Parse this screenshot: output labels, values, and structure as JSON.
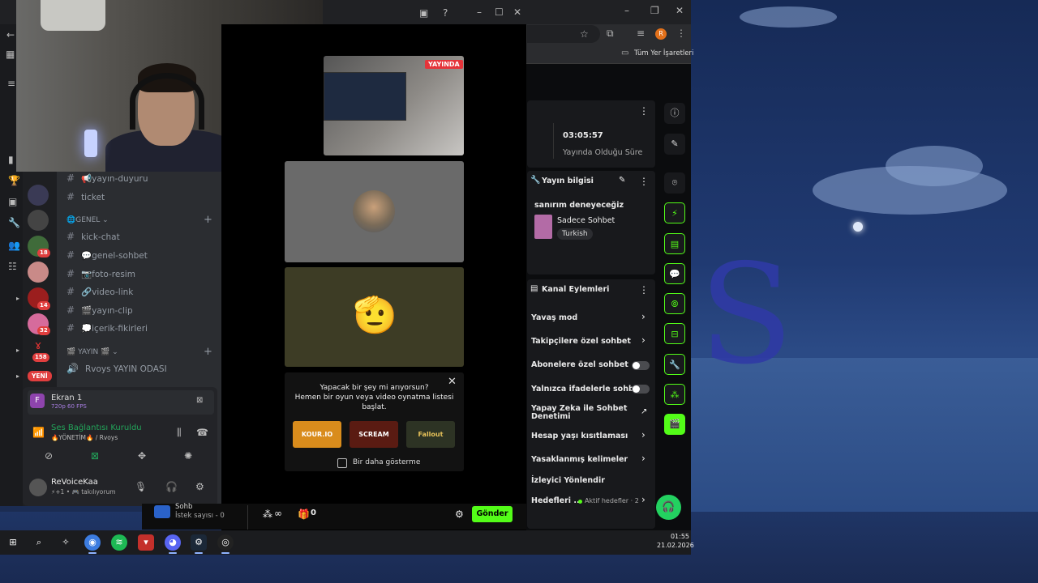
{
  "browser": {
    "bookmarks_label": "Tüm Yer İşaretleri",
    "profile_initial": "R"
  },
  "discord": {
    "channels": [
      {
        "name": "yayın-duyuru",
        "emoji": "📢"
      },
      {
        "name": "ticket",
        "emoji": ""
      }
    ],
    "category_genel": "GENEL",
    "genel_channels": [
      {
        "name": "kick-chat",
        "emoji": ""
      },
      {
        "name": "genel-sohbet",
        "emoji": "💬"
      },
      {
        "name": "foto-resim",
        "emoji": "📷"
      },
      {
        "name": "video-link",
        "emoji": "🔗"
      },
      {
        "name": "yayın-clip",
        "emoji": "🎬"
      },
      {
        "name": "içerik-fikirleri",
        "emoji": "💭"
      }
    ],
    "category_yayin": "YAYIN",
    "voice_channel": "Rvoys YAYIN ODASI",
    "new_badge": "YENİ",
    "server_badges": [
      "18",
      "14",
      "32",
      "158"
    ],
    "screen_share": {
      "title": "Ekran 1",
      "sub": "720p 60 FPS",
      "icon_letter": "F"
    },
    "voice_status": {
      "title": "Ses Bağlantısı Kuruldu",
      "sub": "🔥YÖNETİM🔥 / Rvoys"
    },
    "user": {
      "name": "ReVoiceKaa",
      "status": "⚡+1 • 🎮 takılıyorum"
    }
  },
  "stream_app": {
    "live_tag": "YAYINDA",
    "suggest_line1": "Yapacak bir şey mi arıyorsun?",
    "suggest_line2": "Hemen bir oyun veya video oynatma listesi",
    "suggest_line3": "başlat.",
    "games": [
      {
        "name": "KOUR.IO",
        "color": "#d98c1c"
      },
      {
        "name": "SCREAM",
        "color": "#5a1b12"
      },
      {
        "name": "Fallout",
        "color": "#2d3324"
      }
    ],
    "dont_show": "Bir daha gösterme",
    "viewer_partial": "Sohb",
    "request_count": "İstek sayısı - 0",
    "infinity": "∞",
    "gift_count": "0",
    "send": "Gönder"
  },
  "kick": {
    "stream_time": "03:05:57",
    "stream_time_label": "Yayında Olduğu Süre",
    "info_title": "Yayın bilgisi",
    "stream_title": "sanırım deneyeceğiz",
    "category": "Sadece Sohbet",
    "language": "Turkish",
    "actions_title": "Kanal Eylemleri",
    "actions": [
      {
        "label": "Yavaş mod",
        "control": "chevron"
      },
      {
        "label": "Takipçilere özel sohbet",
        "control": "chevron"
      },
      {
        "label": "Abonelere özel sohbet",
        "control": "toggle"
      },
      {
        "label": "Yalnızca ifadelerle sohbet",
        "control": "toggle"
      },
      {
        "label": "Yapay Zeka ile Sohbet Denetimi",
        "control": "external"
      },
      {
        "label": "Hesap yaşı kısıtlaması",
        "control": "chevron"
      },
      {
        "label": "Yasaklanmış kelimeler",
        "control": "chevron"
      },
      {
        "label": "İzleyici Yönlendir",
        "control": "none"
      },
      {
        "label": "Hedefleri ...",
        "control": "chevron"
      }
    ],
    "goals_status": "Aktif hedefler · 2"
  },
  "taskbar": {
    "time": "01:55",
    "date": "21.02.2026"
  },
  "colors": {
    "kick_green": "#53fc18",
    "live_red": "#e5343a",
    "discord_badge": "#e03e3e"
  }
}
